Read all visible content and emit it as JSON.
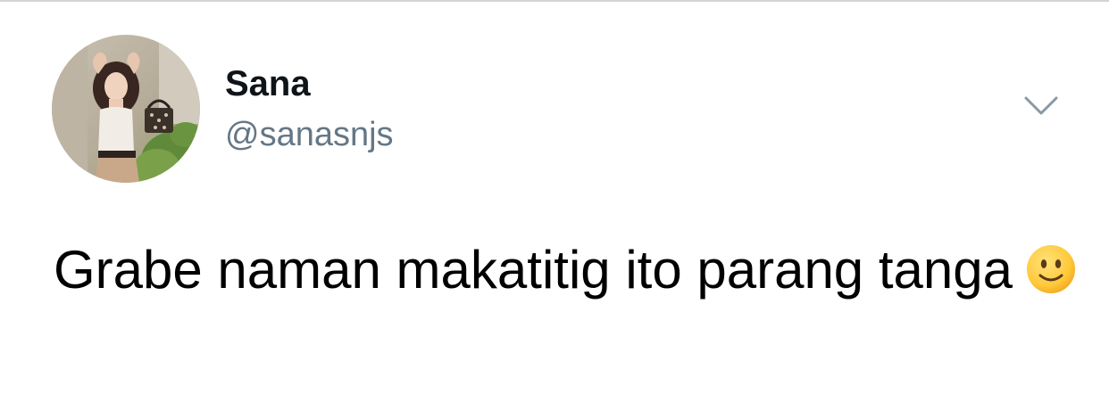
{
  "user": {
    "display_name": "Sana",
    "handle": "@sanasnjs",
    "avatar_icon": "profile-photo"
  },
  "menu": {
    "icon": "chevron-down-icon"
  },
  "tweet": {
    "text": "Grabe naman makatitig ito parang tanga",
    "emoji": "slightly-smiling-face"
  },
  "colors": {
    "name": "#0f1419",
    "handle": "#657786",
    "chevron": "#8899a6",
    "divider": "#d4d4d4"
  }
}
